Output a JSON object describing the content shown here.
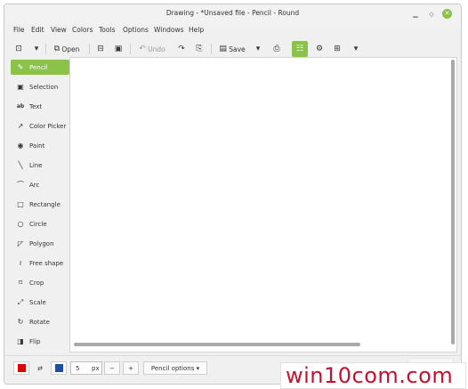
{
  "window": {
    "title": "Drawing - *Unsaved file - Pencil - Round"
  },
  "window_controls": {
    "minimize": "□",
    "maximize": "▫",
    "close": "✕"
  },
  "menubar": {
    "items": [
      "File",
      "Edit",
      "View",
      "Colors",
      "Tools",
      "Options",
      "Windows",
      "Help"
    ]
  },
  "toolbar": {
    "new_icon": "new-image-icon",
    "open_label": "Open",
    "undo_label": "Undo",
    "save_label": "Save"
  },
  "tools": [
    {
      "label": "Pencil",
      "icon": "✎",
      "active": true
    },
    {
      "label": "Selection",
      "icon": "▣",
      "active": false
    },
    {
      "label": "Text",
      "icon": "ab",
      "active": false
    },
    {
      "label": "Color Picker",
      "icon": "↗",
      "active": false
    },
    {
      "label": "Paint",
      "icon": "◉",
      "active": false
    },
    {
      "label": "Line",
      "icon": "╲",
      "active": false
    },
    {
      "label": "Arc",
      "icon": "⌒",
      "active": false
    },
    {
      "label": "Rectangle",
      "icon": "□",
      "active": false
    },
    {
      "label": "Circle",
      "icon": "○",
      "active": false
    },
    {
      "label": "Polygon",
      "icon": "◸",
      "active": false
    },
    {
      "label": "Free shape",
      "icon": "≀",
      "active": false
    },
    {
      "label": "Crop",
      "icon": "⌑",
      "active": false
    },
    {
      "label": "Scale",
      "icon": "⤢",
      "active": false
    },
    {
      "label": "Rotate",
      "icon": "↻",
      "active": false
    },
    {
      "label": "Flip",
      "icon": "◨",
      "active": false
    }
  ],
  "bottombar": {
    "main_color": "#e00000",
    "secondary_color": "#1f4fa0",
    "size_value": "5",
    "size_unit": "px",
    "minus_label": "−",
    "plus_label": "+",
    "options_label": "Pencil options"
  },
  "watermark": {
    "text": "win10com.com"
  },
  "colors": {
    "accent": "#8bc34a",
    "canvas": "#ffffff",
    "window_bg": "#f0f0f0"
  }
}
